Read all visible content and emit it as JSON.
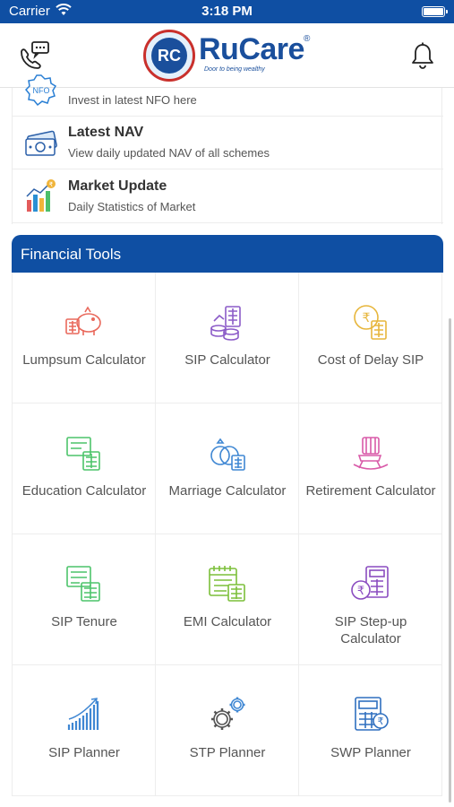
{
  "status_bar": {
    "carrier": "Carrier",
    "time": "3:18 PM"
  },
  "header": {
    "logo": {
      "mark": "RC",
      "name": "RuCare",
      "registered": "®",
      "tagline": "Door to being wealthy"
    },
    "chat_icon": "phone-chat-icon",
    "bell_icon": "bell-icon"
  },
  "list": [
    {
      "icon": "nfo-icon",
      "title": "",
      "subtitle": "Invest in latest NFO here"
    },
    {
      "icon": "banknote-icon",
      "title": "Latest NAV",
      "subtitle": "View daily updated NAV of all schemes"
    },
    {
      "icon": "market-chart-icon",
      "title": "Market Update",
      "subtitle": "Daily Statistics of Market"
    }
  ],
  "financial_tools": {
    "title": "Financial Tools",
    "items": [
      {
        "label": "Lumpsum Calculator",
        "icon": "piggy-bank-icon",
        "color": "#e9695c"
      },
      {
        "label": "SIP Calculator",
        "icon": "coins-icon",
        "color": "#8c5cc8"
      },
      {
        "label": "Cost of Delay SIP",
        "icon": "rupee-coin-icon",
        "color": "#e7b63c"
      },
      {
        "label": "Education Calculator",
        "icon": "education-calc-icon",
        "color": "#4cc46a"
      },
      {
        "label": "Marriage Calculator",
        "icon": "rings-icon",
        "color": "#3f87d3"
      },
      {
        "label": "Retirement Calculator",
        "icon": "rocking-chair-icon",
        "color": "#d95aa8"
      },
      {
        "label": "SIP Tenure",
        "icon": "tenure-calc-icon",
        "color": "#4cc46a"
      },
      {
        "label": "EMI Calculator",
        "icon": "calendar-calc-icon",
        "color": "#7cbf3a"
      },
      {
        "label": "SIP Step-up Calculator",
        "icon": "rupee-calc-icon",
        "color": "#8a4cc0"
      },
      {
        "label": "SIP Planner",
        "icon": "growth-chart-icon",
        "color": "#3f87d3"
      },
      {
        "label": "STP Planner",
        "icon": "gears-icon",
        "color": "#3f87d3"
      },
      {
        "label": "SWP Planner",
        "icon": "rupee-calculator-icon",
        "color": "#2f6fbf"
      }
    ]
  }
}
